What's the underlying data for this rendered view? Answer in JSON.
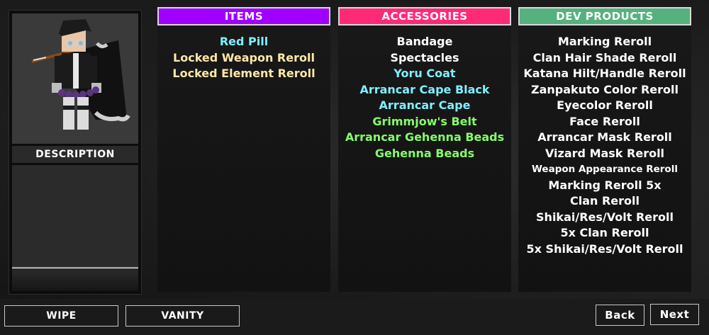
{
  "left_panel": {
    "description_label": "DESCRIPTION"
  },
  "columns": {
    "items": {
      "title": "ITEMS",
      "header_color": "#a000ff",
      "entries": [
        {
          "label": "Red Pill",
          "color": "#7ff0ff"
        },
        {
          "label": "Locked Weapon Reroll",
          "color": "#ffe8a8"
        },
        {
          "label": "Locked Element Reroll",
          "color": "#ffe8a8"
        }
      ]
    },
    "accessories": {
      "title": "ACCESSORIES",
      "header_color": "#ff2a77",
      "entries": [
        {
          "label": "Bandage",
          "color": "#ffffff"
        },
        {
          "label": "Spectacles",
          "color": "#ffffff"
        },
        {
          "label": "Yoru Coat",
          "color": "#7ff0ff"
        },
        {
          "label": "Arrancar Cape Black",
          "color": "#7ff0ff"
        },
        {
          "label": "Arrancar Cape",
          "color": "#7ff0ff"
        },
        {
          "label": "Grimmjow's Belt",
          "color": "#86ff6a"
        },
        {
          "label": "Arrancar Gehenna Beads",
          "color": "#86ff6a"
        },
        {
          "label": "Gehenna Beads",
          "color": "#86ff6a"
        }
      ]
    },
    "dev_products": {
      "title": "DEV PRODUCTS",
      "header_color": "#55b27e",
      "entries": [
        {
          "label": "Marking Reroll",
          "color": "#ffffff"
        },
        {
          "label": "Clan Hair Shade Reroll",
          "color": "#ffffff"
        },
        {
          "label": "Katana Hilt/Handle Reroll",
          "color": "#ffffff"
        },
        {
          "label": "Zanpakuto Color Reroll",
          "color": "#ffffff"
        },
        {
          "label": "Eyecolor Reroll",
          "color": "#ffffff"
        },
        {
          "label": "Face Reroll",
          "color": "#ffffff"
        },
        {
          "label": "Arrancar Mask Reroll",
          "color": "#ffffff"
        },
        {
          "label": "Vizard Mask Reroll",
          "color": "#ffffff"
        },
        {
          "label": "Weapon Appearance Reroll",
          "color": "#ffffff",
          "small": true
        },
        {
          "label": "Marking Reroll 5x",
          "color": "#ffffff"
        },
        {
          "label": "Clan Reroll",
          "color": "#ffffff"
        },
        {
          "label": "Shikai/Res/Volt Reroll",
          "color": "#ffffff"
        },
        {
          "label": "5x Clan Reroll",
          "color": "#ffffff"
        },
        {
          "label": "5x Shikai/Res/Volt Reroll",
          "color": "#ffffff"
        }
      ]
    }
  },
  "bottom_buttons": {
    "wipe": "WIPE",
    "vanity": "VANITY",
    "back": "Back",
    "next": "Next"
  }
}
